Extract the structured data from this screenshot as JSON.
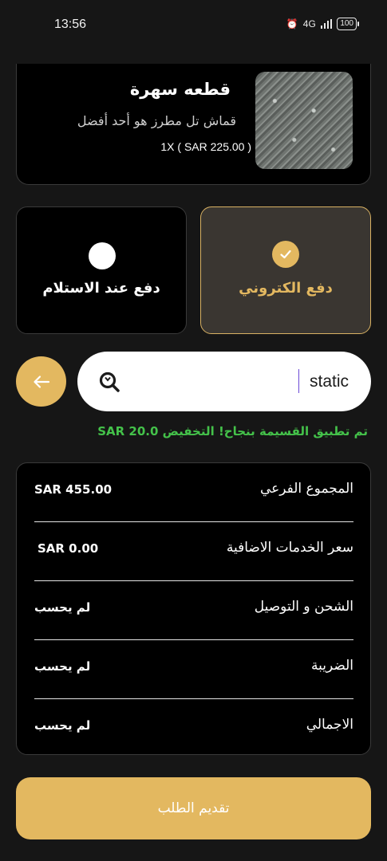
{
  "status_bar": {
    "time": "13:56",
    "network": "4G",
    "battery": "100"
  },
  "product": {
    "name": "قطعه سهرة",
    "description": "قماش تل مطرز هو أحد أفضل",
    "quantity_price": "1X ( SAR 225.00 )"
  },
  "payment": {
    "cash_on_delivery_label": "دفع عند الاستلام",
    "online_label": "دفع الكتروني",
    "selected": "online"
  },
  "coupon": {
    "value": "static",
    "success_message": "تم تطبيق القسيمة بنجاح! التخفيض SAR 20.0"
  },
  "summary": {
    "rows": [
      {
        "label": "المجموع الفرعي",
        "value": "SAR 455.00"
      },
      {
        "label": "سعر الخدمات الاضافية",
        "value": "SAR 0.00"
      },
      {
        "label": "الشحن و التوصيل",
        "value": "لم يحسب"
      },
      {
        "label": "الضريبة",
        "value": "لم يحسب"
      },
      {
        "label": "الاجمالي",
        "value": "لم يحسب"
      }
    ]
  },
  "submit_label": "تقديم الطلب",
  "colors": {
    "accent": "#e3b860",
    "success": "#44c24a",
    "background": "#161616"
  }
}
